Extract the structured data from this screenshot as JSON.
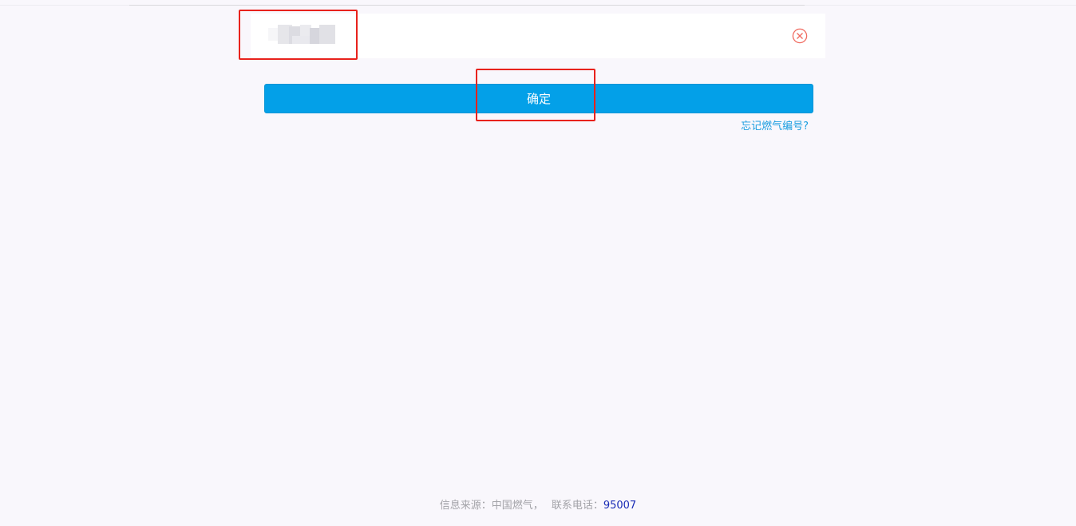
{
  "account_input": {
    "value": "",
    "masked": true
  },
  "icons": {
    "clear": "clear-circle-x-icon",
    "clear_color": "#f06a5f"
  },
  "confirm_button": {
    "label": "确定",
    "color": "#03a0e8"
  },
  "forgot_link": {
    "label": "忘记燃气编号?"
  },
  "footer": {
    "source_label": "信息来源：中国燃气，",
    "phone_label": "联系电话：",
    "phone_number": "95007"
  },
  "annotation_color": "#e8221c"
}
